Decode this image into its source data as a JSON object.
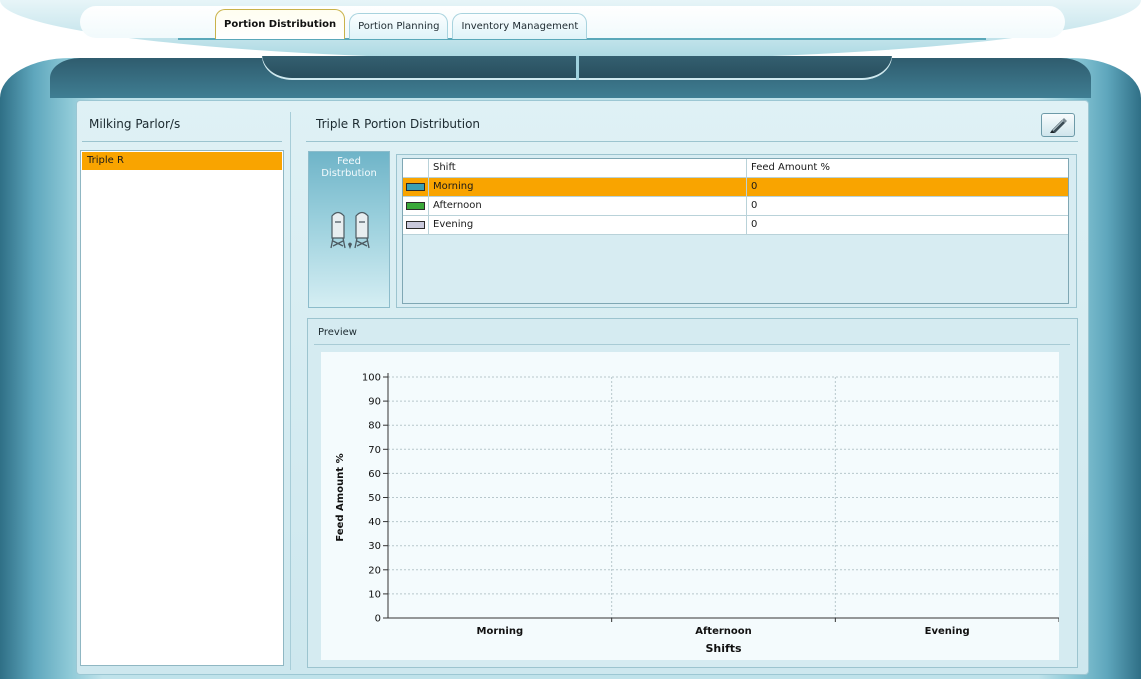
{
  "tabs": [
    {
      "label": "Portion Distribution",
      "active": true
    },
    {
      "label": "Portion Planning",
      "active": false
    },
    {
      "label": "Inventory Management",
      "active": false
    }
  ],
  "left_panel": {
    "title": "Milking Parlor/s",
    "items": [
      {
        "label": "Triple R",
        "selected": true
      }
    ]
  },
  "right_panel": {
    "title": "Triple R Portion Distribution",
    "edit_icon": "pencil-icon",
    "feed_panel": {
      "label_line1": "Feed",
      "label_line2": "Distrbution",
      "icon": "silo-icon"
    }
  },
  "grid": {
    "columns": [
      "Shift",
      "Feed Amount %"
    ],
    "rows": [
      {
        "shift": "Morning",
        "amount": "0",
        "color": "#3a9fb2",
        "selected": true
      },
      {
        "shift": "Afternoon",
        "amount": "0",
        "color": "#3aa83a",
        "selected": false
      },
      {
        "shift": "Evening",
        "amount": "0",
        "color": "#c9c9dc",
        "selected": false
      }
    ]
  },
  "preview": {
    "title": "Preview"
  },
  "colors": {
    "selection": "#f9a400",
    "accent": "#5aa8b9"
  },
  "chart_data": {
    "type": "bar",
    "categories": [
      "Morning",
      "Afternoon",
      "Evening"
    ],
    "series": [
      {
        "values": [
          0,
          0,
          0
        ]
      }
    ],
    "xlabel": "Shifts",
    "ylabel": "Feed Amount %",
    "ylim": [
      0,
      100
    ],
    "yticks": [
      "0",
      "10",
      "20",
      "30",
      "40",
      "50",
      "60",
      "70",
      "80",
      "90",
      "100"
    ],
    "grid": true
  }
}
